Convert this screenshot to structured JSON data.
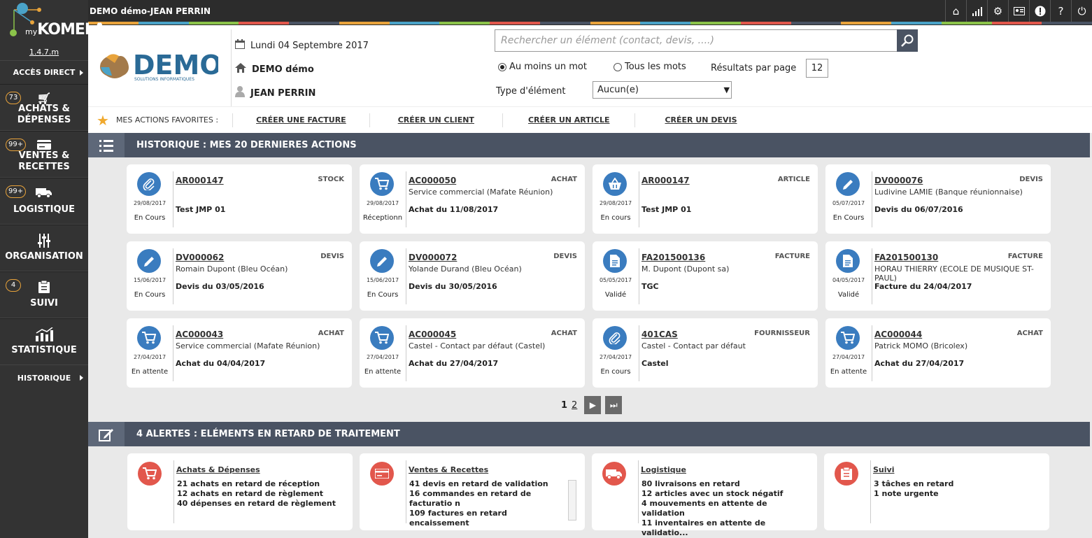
{
  "app": {
    "title": "DEMO démo-JEAN PERRIN",
    "brand": "KOMELA",
    "brand_prefix": "my",
    "version": "1.4.7.m"
  },
  "topbar_icons": [
    "home-icon",
    "chart-icon",
    "gear-icon",
    "id-card-icon",
    "alert-icon",
    "help-icon",
    "power-icon"
  ],
  "stripe_colors": [
    "#e8a33b",
    "#4aa3c8",
    "#8bc34a",
    "#e2574c",
    "#4a5363",
    "#e8a33b",
    "#4aa3c8",
    "#8bc34a",
    "#e2574c",
    "#4a5363",
    "#e8a33b",
    "#4aa3c8",
    "#8bc34a",
    "#e2574c",
    "#4a5363",
    "#e8a33b",
    "#4aa3c8",
    "#8bc34a",
    "#e2574c",
    "#4a5363"
  ],
  "sidebar": {
    "direct": "ACCÈS DIRECT",
    "items": [
      {
        "label1": "ACHATS &",
        "label2": "DÉPENSES",
        "badge": "73",
        "icon": "cart-icon"
      },
      {
        "label1": "VENTES &",
        "label2": "RECETTES",
        "badge": "99+",
        "icon": "card-icon"
      },
      {
        "label1": "LOGISTIQUE",
        "label2": "",
        "badge": "99+",
        "icon": "truck-icon"
      },
      {
        "label1": "ORGANISATION",
        "label2": "",
        "badge": "",
        "icon": "sliders-icon"
      },
      {
        "label1": "SUIVI",
        "label2": "",
        "badge": "4",
        "icon": "clipboard-icon"
      },
      {
        "label1": "STATISTIQUE",
        "label2": "",
        "badge": "",
        "icon": "stats-icon"
      }
    ],
    "history": "HISTORIQUE"
  },
  "header": {
    "logo_text": "DEMO",
    "logo_sub": "SOLUTIONS INFORMATIQUES",
    "date": "Lundi 04 Septembre 2017",
    "company": "DEMO démo",
    "user": "JEAN PERRIN",
    "search_placeholder": "Rechercher un élément (contact, devis, ....)",
    "opt_any": "Au moins un mot",
    "opt_all": "Tous les mots",
    "results_label": "Résultats par page",
    "results_value": "12",
    "type_label": "Type d'élément",
    "type_value": "Aucun(e)"
  },
  "favorites": {
    "label": "MES ACTIONS FAVORITES :",
    "links": [
      "CRÉER UNE FACTURE",
      "CRÉER UN CLIENT",
      "CRÉER UN ARTICLE",
      "CRÉER UN DEVIS"
    ]
  },
  "history": {
    "title": "HISTORIQUE : MES 20 DERNIERES ACTIONS",
    "cards": [
      {
        "ref": "AR000147",
        "type": "STOCK",
        "sub": "",
        "desc": "Test JMP 01",
        "date": "29/08/2017",
        "status": "En Cours",
        "icon": "paperclip-icon"
      },
      {
        "ref": "AC000050",
        "type": "ACHAT",
        "sub": "Service commercial (Mafate Réunion)",
        "desc": "Achat du 11/08/2017",
        "date": "29/08/2017",
        "status": "Réceptionn",
        "icon": "cart-icon"
      },
      {
        "ref": "AR000147",
        "type": "ARTICLE",
        "sub": "",
        "desc": "Test JMP 01",
        "date": "29/08/2017",
        "status": "En cours",
        "icon": "basket-icon"
      },
      {
        "ref": "DV000076",
        "type": "DEVIS",
        "sub": "Ludivine LAMIE (Banque réunionnaise)",
        "desc": "Devis du 06/07/2016",
        "date": "05/07/2017",
        "status": "En Cours",
        "icon": "pencil-icon"
      },
      {
        "ref": "DV000062",
        "type": "DEVIS",
        "sub": "Romain Dupont (Bleu Océan)",
        "desc": "Devis du 03/05/2016",
        "date": "15/06/2017",
        "status": "En Cours",
        "icon": "pencil-icon"
      },
      {
        "ref": "DV000072",
        "type": "DEVIS",
        "sub": "Yolande Durand (Bleu Océan)",
        "desc": "Devis du 30/05/2016",
        "date": "15/06/2017",
        "status": "En Cours",
        "icon": "pencil-icon"
      },
      {
        "ref": "FA201500136",
        "type": "FACTURE",
        "sub": "M. Dupont (Dupont sa)",
        "desc": "TGC",
        "date": "05/05/2017",
        "status": "Validé",
        "icon": "document-icon"
      },
      {
        "ref": "FA201500130",
        "type": "FACTURE",
        "sub": "HORAU THIERRY (ECOLE DE MUSIQUE ST-PAUL)",
        "desc": "Facture du 24/04/2017",
        "date": "04/05/2017",
        "status": "Validé",
        "icon": "document-icon"
      },
      {
        "ref": "AC000043",
        "type": "ACHAT",
        "sub": "Service commercial (Mafate Réunion)",
        "desc": "Achat du 04/04/2017",
        "date": "27/04/2017",
        "status": "En attente",
        "icon": "cart-icon"
      },
      {
        "ref": "AC000045",
        "type": "ACHAT",
        "sub": "Castel - Contact par défaut (Castel)",
        "desc": "Achat du 27/04/2017",
        "date": "27/04/2017",
        "status": "En attente",
        "icon": "cart-icon"
      },
      {
        "ref": "401CAS",
        "type": "FOURNISSEUR",
        "sub": "Castel - Contact par défaut",
        "desc": "Castel",
        "date": "27/04/2017",
        "status": "En cours",
        "icon": "paperclip-icon"
      },
      {
        "ref": "AC000044",
        "type": "ACHAT",
        "sub": "Patrick MOMO (Bricolex)",
        "desc": "Achat du 27/04/2017",
        "date": "27/04/2017",
        "status": "En attente",
        "icon": "cart-icon"
      }
    ]
  },
  "pager": {
    "page1": "1",
    "page2": "2"
  },
  "alerts": {
    "title": "4 ALERTES : ELÉMENTS EN RETARD DE TRAITEMENT",
    "cards": [
      {
        "title": "Achats & Dépenses",
        "icon": "cart-icon",
        "lines": [
          "21 achats en retard de réception",
          "12 achats en retard de règlement",
          "40 dépenses en retard de règlement"
        ]
      },
      {
        "title": "Ventes & Recettes",
        "icon": "card-icon",
        "lines": [
          "41 devis en retard de validation",
          "16 commandes en retard de facturatio n",
          "109 factures en retard encaissement"
        ]
      },
      {
        "title": "Logistique",
        "icon": "truck-icon",
        "lines": [
          "80 livraisons en retard",
          "12 articles avec un stock négatif",
          "4 mouvements en attente de validation",
          "11 inventaires en attente de validatio..."
        ]
      },
      {
        "title": "Suivi",
        "icon": "clipboard-icon",
        "lines": [
          "3 tâches en retard",
          "1 note urgente"
        ]
      }
    ]
  },
  "colors": {
    "accent_blue": "#3a7cbf",
    "alert_red": "#e2574c",
    "section_bar": "#4a5363",
    "badge_orange": "#e8a33b"
  }
}
